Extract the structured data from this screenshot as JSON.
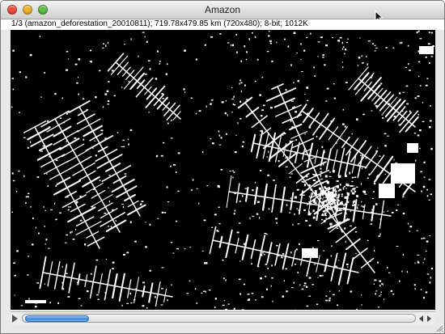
{
  "window": {
    "title": "Amazon",
    "info_line": "1/3 (amazon_deforestation_20010811); 719.78x479.85 km (720x480); 8-bit; 1012K"
  },
  "controls": {
    "close_color": "#ee4b3e",
    "minimize_color": "#f0b42a",
    "zoom_color": "#5fbf45"
  },
  "image": {
    "description_icon": "satellite-image",
    "slice_position": 1,
    "slice_count": 3
  },
  "slider": {
    "progress_fraction": 0.33,
    "accent": "#3c86d8"
  }
}
